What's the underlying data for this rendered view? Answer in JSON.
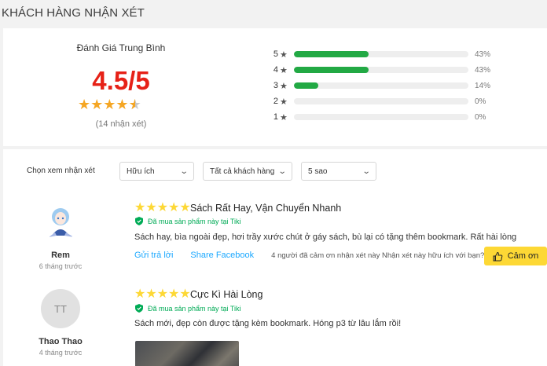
{
  "section_title": "KHÁCH HÀNG NHẬN XÉT",
  "summary": {
    "avg_title": "Đánh Giá Trung Bình",
    "avg_score": "4.5/5",
    "avg_rating": 4.5,
    "count_text": "(14 nhận xét)",
    "breakdown": [
      {
        "stars": "5",
        "percent_text": "43%",
        "fraction": 0.43
      },
      {
        "stars": "4",
        "percent_text": "43%",
        "fraction": 0.43
      },
      {
        "stars": "3",
        "percent_text": "14%",
        "fraction": 0.14
      },
      {
        "stars": "2",
        "percent_text": "0%",
        "fraction": 0
      },
      {
        "stars": "1",
        "percent_text": "0%",
        "fraction": 0
      }
    ]
  },
  "filter": {
    "label": "Chọn xem nhận xét",
    "sort_value": "Hữu ích",
    "customer_value": "Tất cả khách hàng",
    "star_value": "5 sao"
  },
  "reviews": [
    {
      "name": "Rem",
      "time": "6 tháng trước",
      "rating": 5,
      "title": "Sách Rất Hay, Vận Chuyển Nhanh",
      "verified": "Đã mua sản phẩm này tại Tiki",
      "body": "Sách hay, bìa ngoài đẹp, hơi trầy xước chút ở gáy sách, bù lại có tặng thêm bookmark. Rất hài lòng",
      "reply_label": "Gửi trả lời",
      "share_label": "Share Facebook",
      "thanks_text": "4 người đã cảm ơn nhận xét này Nhận xét này hữu ích với bạn?",
      "thanks_button": "Cảm ơn"
    },
    {
      "name": "Thao Thao",
      "initials": "TT",
      "time": "4 tháng trước",
      "rating": 5,
      "title": "Cực Kì Hài Lòng",
      "verified": "Đã mua sản phẩm này tại Tiki",
      "body": "Sách mới, đẹp còn được tặng kèm bookmark. Hóng p3 từ lâu lắm rồi!"
    }
  ],
  "colors": {
    "accent_red": "#e62117",
    "bar_green": "#22a944",
    "star_yellow": "#fdd836",
    "link_blue": "#1ba8ff",
    "button_yellow": "#fdd835",
    "verified_green": "#00ab56"
  },
  "icons": {
    "star": "star-icon",
    "shield": "shield-check-icon",
    "thumbs_up": "thumbs-up-icon",
    "chevron": "chevron-down-icon"
  }
}
